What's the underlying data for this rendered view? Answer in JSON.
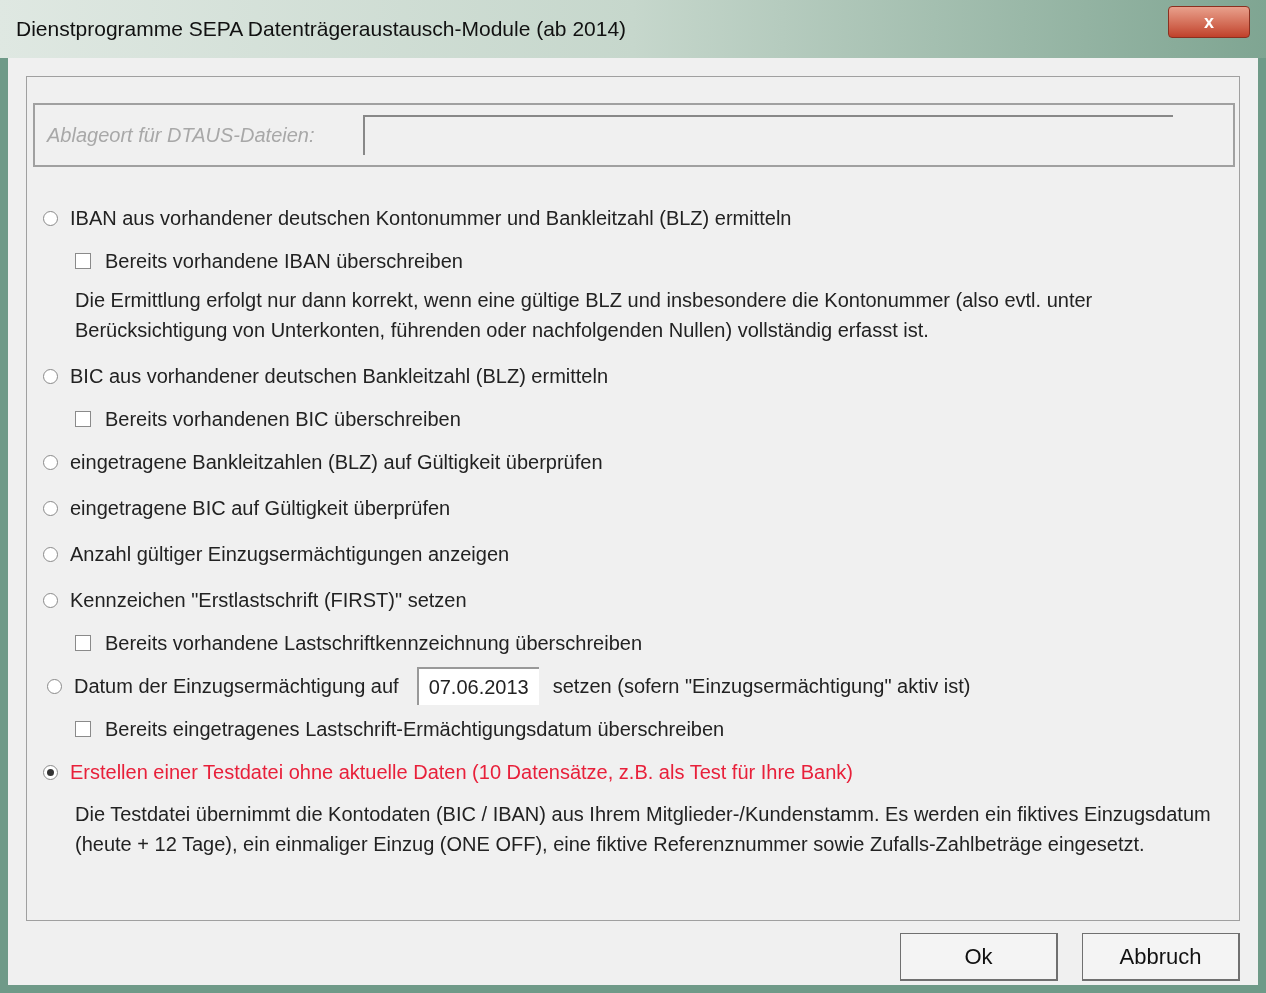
{
  "window": {
    "title": "Dienstprogramme SEPA Datenträgeraustausch-Module (ab 2014)",
    "close": "x"
  },
  "storage": {
    "label": "Ablageort für DTAUS-Dateien:",
    "disabled": true
  },
  "options": [
    {
      "kind": "radio",
      "label": "IBAN aus vorhandener deutschen Kontonummer und Bankleitzahl (BLZ) ermitteln",
      "selected": false
    },
    {
      "kind": "checkbox",
      "label": "Bereits vorhandene IBAN überschreiben",
      "checked": false
    },
    {
      "kind": "note",
      "text": "Die Ermittlung erfolgt nur dann korrekt, wenn eine gültige BLZ und insbesondere die Kontonummer (also evtl. unter Berücksichtigung von Unterkonten, führenden oder nachfolgenden Nullen) vollständig erfasst ist."
    },
    {
      "kind": "radio",
      "label": "BIC aus vorhandener deutschen Bankleitzahl (BLZ) ermitteln",
      "selected": false
    },
    {
      "kind": "checkbox",
      "label": "Bereits vorhandenen BIC überschreiben",
      "checked": false
    },
    {
      "kind": "radio",
      "label": "eingetragene Bankleitzahlen (BLZ) auf Gültigkeit überprüfen",
      "selected": false
    },
    {
      "kind": "radio",
      "label": "eingetragene BIC auf Gültigkeit überprüfen",
      "selected": false
    },
    {
      "kind": "radio",
      "label": "Anzahl gültiger Einzugsermächtigungen anzeigen",
      "selected": false
    },
    {
      "kind": "radio",
      "label": "Kennzeichen \"Erstlastschrift (FIRST)\" setzen",
      "selected": false
    },
    {
      "kind": "checkbox",
      "label": "Bereits vorhandene Lastschriftkennzeichnung überschreiben",
      "checked": false
    },
    {
      "kind": "date",
      "label": "Datum der Einzugsermächtigung auf",
      "value": "07.06.2013",
      "suffix": "setzen (sofern \"Einzugsermächtigung\" aktiv ist)",
      "selected": false
    },
    {
      "kind": "checkbox",
      "label": "Bereits eingetragenes Lastschrift-Ermächtigungsdatum überschreiben",
      "checked": false
    },
    {
      "kind": "radio",
      "label": "Erstellen einer Testdatei ohne aktuelle Daten (10 Datensätze, z.B. als Test für Ihre Bank)",
      "selected": true
    },
    {
      "kind": "note",
      "text": "Die Testdatei übernimmt die Kontodaten (BIC / IBAN) aus Ihrem Mitglieder-/Kundenstamm. Es werden ein fiktives Einzugsdatum (heute + 12 Tage), ein einmaliger Einzug (ONE OFF), eine fiktive Referenznummer sowie Zufalls-Zahlbeträge eingesetzt."
    }
  ],
  "buttons": [
    "Ok",
    "Abbruch"
  ]
}
